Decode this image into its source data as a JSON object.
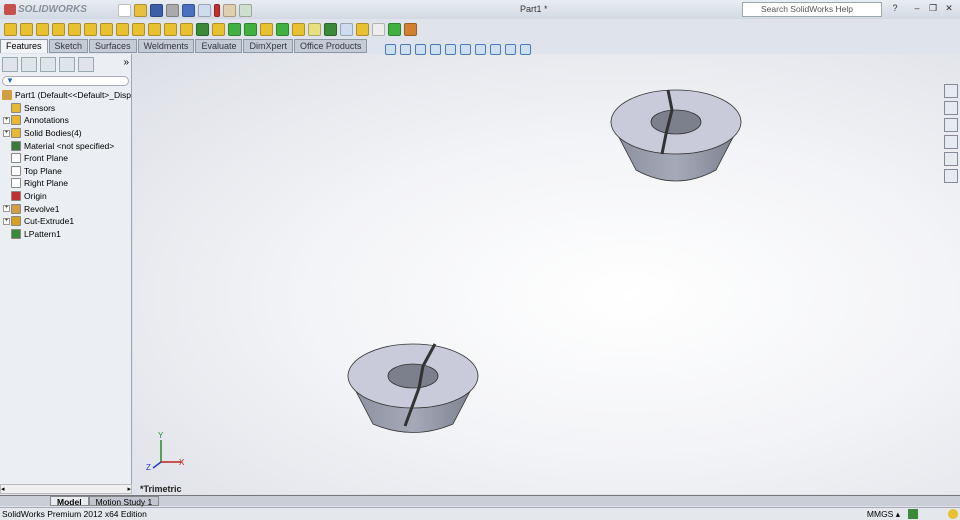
{
  "app": {
    "logo": "SOLIDWORKS",
    "title": "Part1 *",
    "search_placeholder": "Search SolidWorks Help"
  },
  "command_tabs": [
    "Features",
    "Sketch",
    "Surfaces",
    "Weldments",
    "Evaluate",
    "DimXpert",
    "Office Products"
  ],
  "tree": {
    "root": "Part1  (Default<<Default>_Disp",
    "items": [
      {
        "label": "Sensors",
        "expand": false,
        "color": "#e8b830"
      },
      {
        "label": "Annotations",
        "expand": true,
        "color": "#e8b830"
      },
      {
        "label": "Solid Bodies(4)",
        "expand": true,
        "color": "#e8b830"
      },
      {
        "label": "Material <not specified>",
        "expand": false,
        "color": "#3a7a3a"
      },
      {
        "label": "Front Plane",
        "expand": false,
        "color": "#ffffff"
      },
      {
        "label": "Top Plane",
        "expand": false,
        "color": "#ffffff"
      },
      {
        "label": "Right Plane",
        "expand": false,
        "color": "#ffffff"
      },
      {
        "label": "Origin",
        "expand": false,
        "color": "#c03030"
      },
      {
        "label": "Revolve1",
        "expand": true,
        "color": "#d0a040"
      },
      {
        "label": "Cut-Extrude1",
        "expand": true,
        "color": "#d8a020"
      },
      {
        "label": "LPattern1",
        "expand": false,
        "color": "#3a8a3a"
      }
    ]
  },
  "viewport": {
    "view_label": "*Trimetric",
    "axes": {
      "x": "X",
      "y": "Y",
      "z": "Z"
    }
  },
  "bottom_tabs": [
    "Model",
    "Motion Study 1"
  ],
  "status": {
    "edition": "SolidWorks Premium 2012 x64 Edition",
    "units": "MMGS"
  }
}
